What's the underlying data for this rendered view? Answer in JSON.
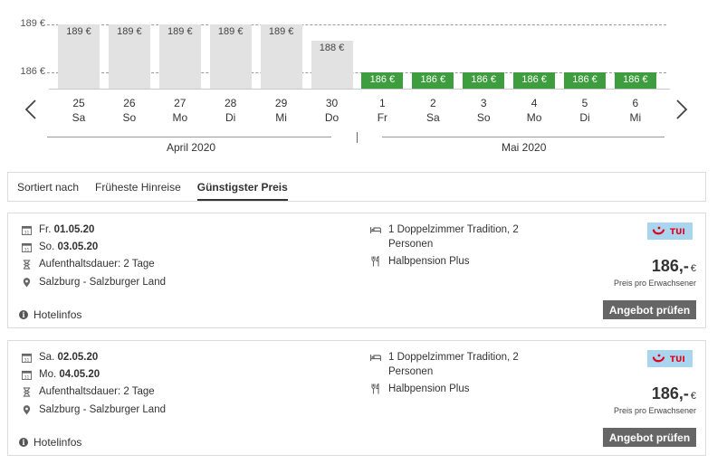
{
  "chart": {
    "y_ticks": [
      "189 €",
      "186 €"
    ],
    "bars": [
      {
        "label": "189 €",
        "value": 189,
        "color": "#e2e2e2",
        "best": false
      },
      {
        "label": "189 €",
        "value": 189,
        "color": "#e2e2e2",
        "best": false
      },
      {
        "label": "189 €",
        "value": 189,
        "color": "#e2e2e2",
        "best": false
      },
      {
        "label": "189 €",
        "value": 189,
        "color": "#e2e2e2",
        "best": false
      },
      {
        "label": "189 €",
        "value": 189,
        "color": "#e2e2e2",
        "best": false
      },
      {
        "label": "188 €",
        "value": 188,
        "color": "#e2e2e2",
        "best": false
      },
      {
        "label": "186 €",
        "value": 186,
        "color": "#3e9d3e",
        "best": true
      },
      {
        "label": "186 €",
        "value": 186,
        "color": "#3e9d3e",
        "best": true
      },
      {
        "label": "186 €",
        "value": 186,
        "color": "#3e9d3e",
        "best": true
      },
      {
        "label": "186 €",
        "value": 186,
        "color": "#3e9d3e",
        "best": true
      },
      {
        "label": "186 €",
        "value": 186,
        "color": "#3e9d3e",
        "best": true
      },
      {
        "label": "186 €",
        "value": 186,
        "color": "#3e9d3e",
        "best": true
      }
    ],
    "days": [
      {
        "num": "25",
        "wd": "Sa"
      },
      {
        "num": "26",
        "wd": "So"
      },
      {
        "num": "27",
        "wd": "Mo"
      },
      {
        "num": "28",
        "wd": "Di"
      },
      {
        "num": "29",
        "wd": "Mi"
      },
      {
        "num": "30",
        "wd": "Do"
      },
      {
        "num": "1",
        "wd": "Fr"
      },
      {
        "num": "2",
        "wd": "Sa"
      },
      {
        "num": "3",
        "wd": "So"
      },
      {
        "num": "4",
        "wd": "Mo"
      },
      {
        "num": "5",
        "wd": "Di"
      },
      {
        "num": "6",
        "wd": "Mi"
      }
    ],
    "months": [
      "April 2020",
      "Mai 2020"
    ],
    "prev_icon": "chevron-left-icon",
    "next_icon": "chevron-right-icon"
  },
  "chart_data": {
    "type": "bar",
    "categories": [
      "25 Sa",
      "26 So",
      "27 Mo",
      "28 Di",
      "29 Mi",
      "30 Do",
      "1 Fr",
      "2 Sa",
      "3 So",
      "4 Mo",
      "5 Di",
      "6 Mi"
    ],
    "values": [
      189,
      189,
      189,
      189,
      189,
      188,
      186,
      186,
      186,
      186,
      186,
      186
    ],
    "ylim": [
      185,
      189
    ],
    "yticks": [
      189,
      186
    ],
    "colors": {
      "regular": "#e2e2e2",
      "lowest": "#3e9d3e"
    }
  },
  "sort": {
    "label": "Sortiert nach",
    "options": [
      "Früheste Hinreise",
      "Günstigster Preis"
    ],
    "active": "Günstigster Preis"
  },
  "offers": [
    {
      "depart_wd": "Fr.",
      "depart_date": "01.05.20",
      "return_wd": "So.",
      "return_date": "03.05.20",
      "duration": "Aufenthaltsdauer: 2 Tage",
      "location": "Salzburg - Salzburger Land",
      "room": "1 Doppelzimmer Tradition, 2 Personen",
      "board": "Halbpension Plus",
      "operator": "TUI",
      "price": "186,-",
      "currency": "€",
      "price_note": "Preis pro Erwachsener",
      "cta": "Angebot prüfen",
      "hotelinfo": "Hotelinfos"
    },
    {
      "depart_wd": "Sa.",
      "depart_date": "02.05.20",
      "return_wd": "Mo.",
      "return_date": "04.05.20",
      "duration": "Aufenthaltsdauer: 2 Tage",
      "location": "Salzburg - Salzburger Land",
      "room": "1 Doppelzimmer Tradition, 2 Personen",
      "board": "Halbpension Plus",
      "operator": "TUI",
      "price": "186,-",
      "currency": "€",
      "price_note": "Preis pro Erwachsener",
      "cta": "Angebot prüfen",
      "hotelinfo": "Hotelinfos"
    }
  ],
  "colors": {
    "best_price": "#3e9d3e",
    "regular_price": "#e2e2e2",
    "button": "#666666",
    "tui_logo_bg": "#a9d5ef",
    "tui_red": "#e2001a"
  }
}
